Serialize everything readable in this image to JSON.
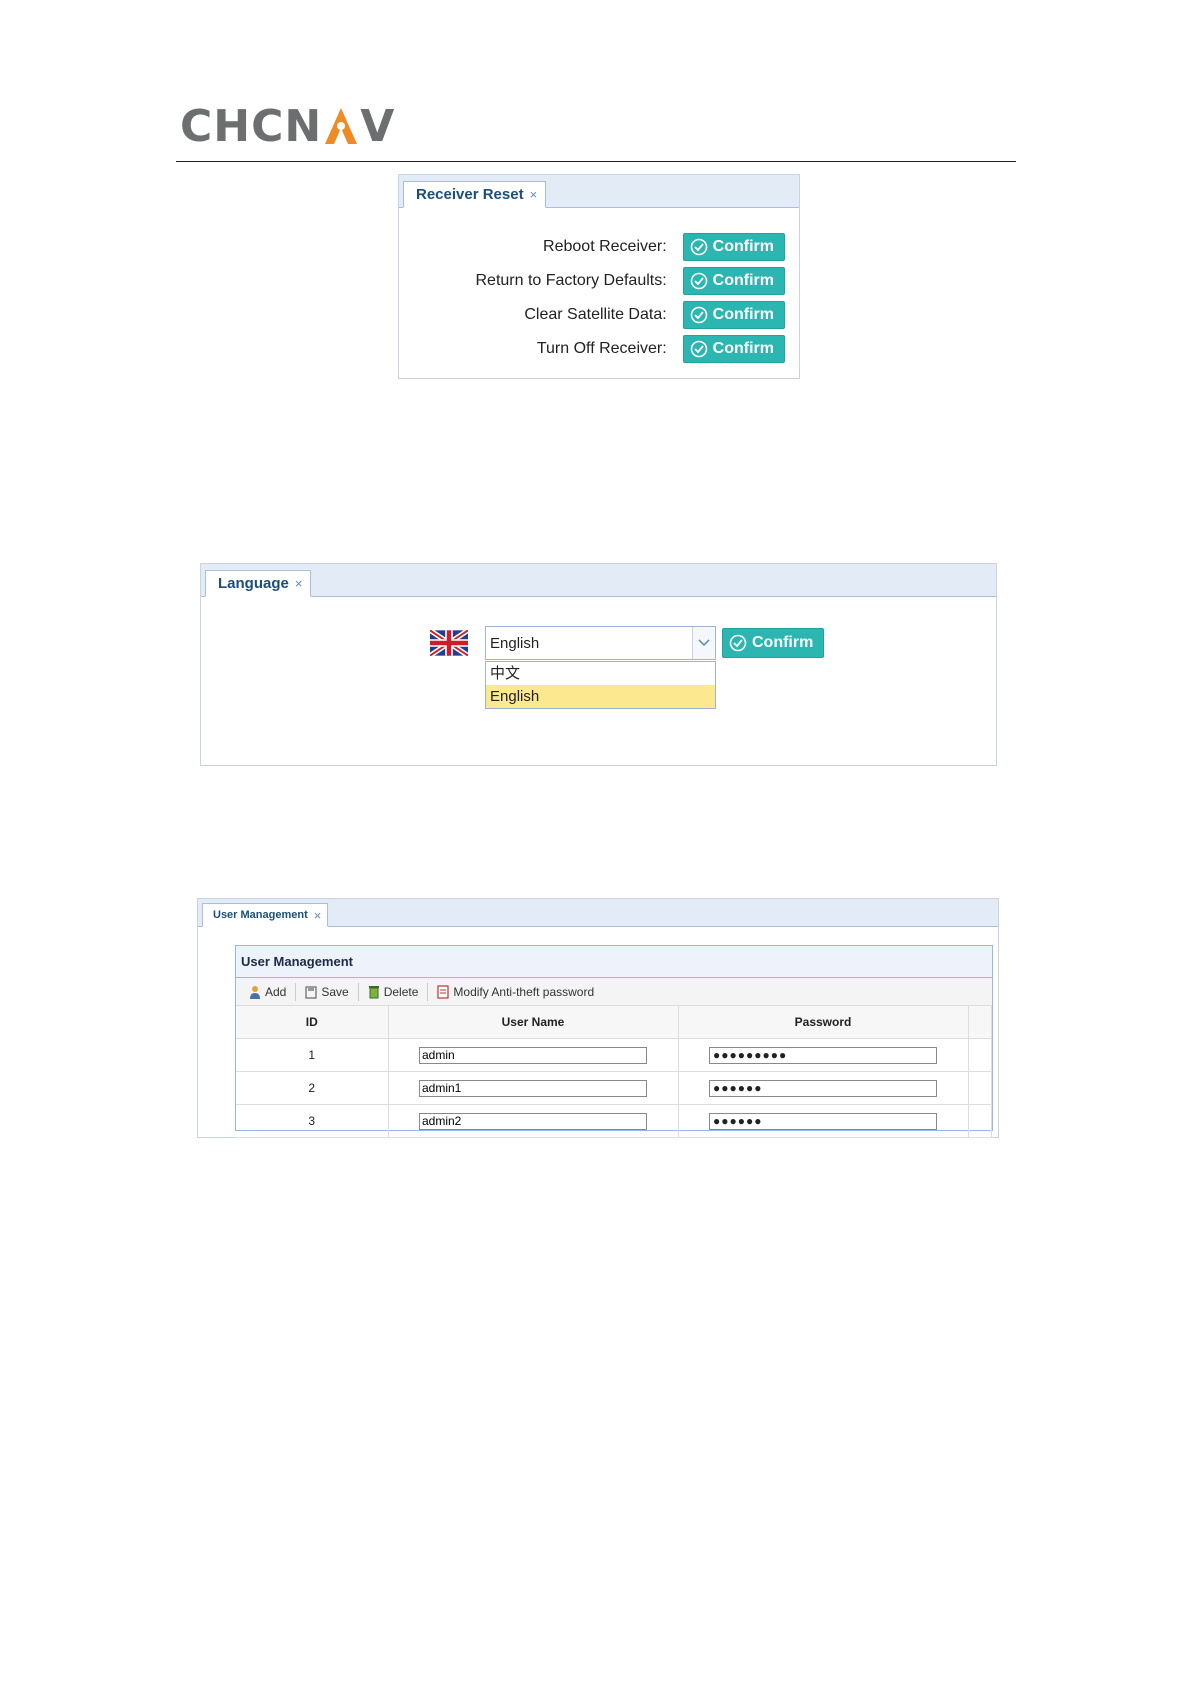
{
  "logo": {
    "text_left": "CHCN",
    "text_right": "V"
  },
  "receiver_reset": {
    "tab_label": "Receiver Reset",
    "close": "×",
    "rows": [
      {
        "label": "Reboot Receiver:",
        "button": "Confirm"
      },
      {
        "label": "Return to Factory Defaults:",
        "button": "Confirm"
      },
      {
        "label": "Clear Satellite Data:",
        "button": "Confirm"
      },
      {
        "label": "Turn Off Receiver:",
        "button": "Confirm"
      }
    ]
  },
  "language": {
    "tab_label": "Language",
    "close": "×",
    "selected": "English",
    "options": [
      "中文",
      "English"
    ],
    "button": "Confirm",
    "flag_icon": "uk-flag-icon"
  },
  "user_management": {
    "tab_label": "User Management",
    "close": "×",
    "section_title": "User Management",
    "toolbar": {
      "add": "Add",
      "save": "Save",
      "delete": "Delete",
      "modify": "Modify Anti-theft password"
    },
    "columns": [
      "ID",
      "User Name",
      "Password"
    ],
    "rows": [
      {
        "id": "1",
        "username": "admin",
        "password": "●●●●●●●●●"
      },
      {
        "id": "2",
        "username": "admin1",
        "password": "●●●●●●"
      },
      {
        "id": "3",
        "username": "admin2",
        "password": "●●●●●●"
      }
    ]
  },
  "colors": {
    "accent": "#2bb6b1",
    "tabbar": "#e3ebf7",
    "selected_option": "#fbe88f",
    "logo_orange": "#f08a24"
  }
}
